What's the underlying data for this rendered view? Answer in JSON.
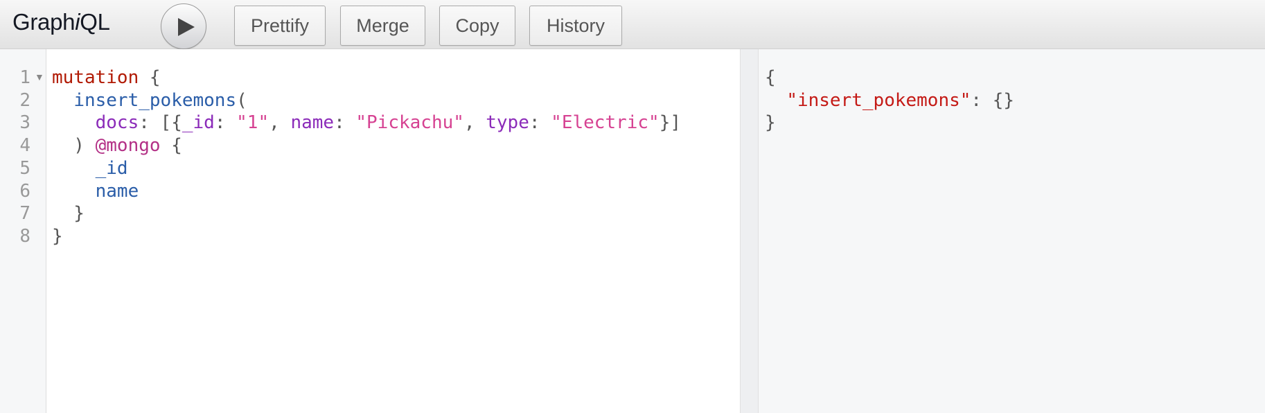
{
  "toolbar": {
    "title_prefix": "Graph",
    "title_italic": "i",
    "title_suffix": "QL",
    "buttons": [
      {
        "label": "Prettify"
      },
      {
        "label": "Merge"
      },
      {
        "label": "Copy"
      },
      {
        "label": "History"
      }
    ]
  },
  "editor": {
    "line_numbers": [
      "1",
      "2",
      "3",
      "4",
      "5",
      "6",
      "7",
      "8"
    ],
    "lines": [
      [
        {
          "t": "mutation",
          "c": "kw"
        },
        {
          "t": " {",
          "c": "punct"
        }
      ],
      [
        {
          "t": "  ",
          "c": ""
        },
        {
          "t": "insert_pokemons",
          "c": "def"
        },
        {
          "t": "(",
          "c": "punct"
        }
      ],
      [
        {
          "t": "    ",
          "c": ""
        },
        {
          "t": "docs",
          "c": "attr"
        },
        {
          "t": ": [{",
          "c": "punct"
        },
        {
          "t": "_id",
          "c": "attr"
        },
        {
          "t": ": ",
          "c": "punct"
        },
        {
          "t": "\"1\"",
          "c": "str"
        },
        {
          "t": ", ",
          "c": "punct"
        },
        {
          "t": "name",
          "c": "attr"
        },
        {
          "t": ": ",
          "c": "punct"
        },
        {
          "t": "\"Pickachu\"",
          "c": "str"
        },
        {
          "t": ", ",
          "c": "punct"
        },
        {
          "t": "type",
          "c": "attr"
        },
        {
          "t": ": ",
          "c": "punct"
        },
        {
          "t": "\"Electric\"",
          "c": "str"
        },
        {
          "t": "}]",
          "c": "punct"
        }
      ],
      [
        {
          "t": "  ) ",
          "c": "punct"
        },
        {
          "t": "@mongo",
          "c": "dir"
        },
        {
          "t": " {",
          "c": "punct"
        }
      ],
      [
        {
          "t": "    ",
          "c": ""
        },
        {
          "t": "_id",
          "c": "def"
        }
      ],
      [
        {
          "t": "    ",
          "c": ""
        },
        {
          "t": "name",
          "c": "def"
        }
      ],
      [
        {
          "t": "  }",
          "c": "punct"
        }
      ],
      [
        {
          "t": "}",
          "c": "punct"
        }
      ]
    ]
  },
  "result": {
    "lines": [
      [
        {
          "t": "{",
          "c": "punct"
        }
      ],
      [
        {
          "t": "  ",
          "c": ""
        },
        {
          "t": "\"insert_pokemons\"",
          "c": "rstr"
        },
        {
          "t": ": {}",
          "c": "punct"
        }
      ],
      [
        {
          "t": "}",
          "c": "punct"
        }
      ]
    ]
  },
  "icons": {
    "execute": "play-icon",
    "fold": "fold-arrow-icon"
  }
}
